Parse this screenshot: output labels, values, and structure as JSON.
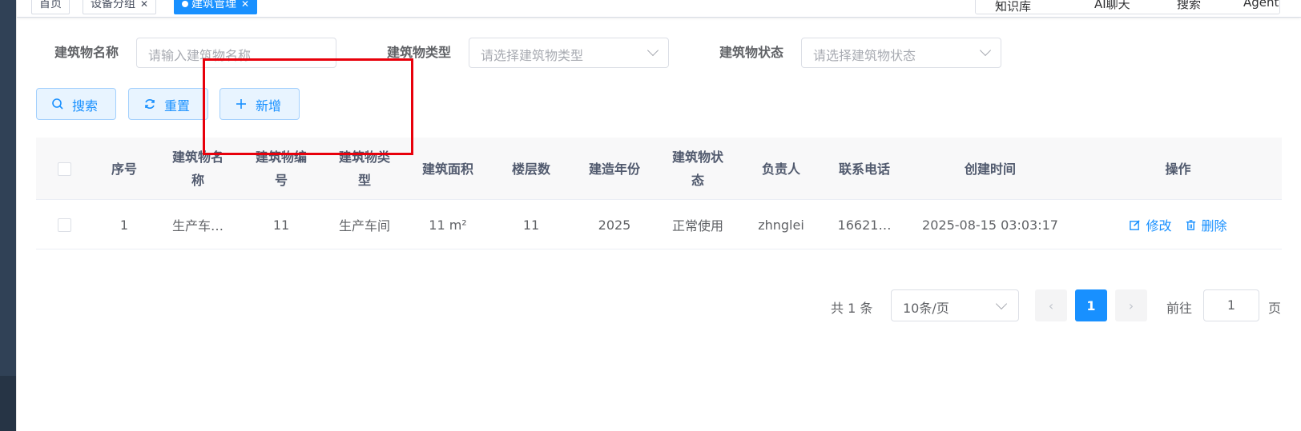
{
  "tags": [
    {
      "label": "首页"
    },
    {
      "label": "设备分组"
    },
    {
      "label": "建筑管理"
    }
  ],
  "topnav": {
    "knowledge": "知识库",
    "ai_chat": "AI聊天",
    "search": "搜索",
    "agent": "Agent"
  },
  "filters": {
    "name_label": "建筑物名称",
    "name_placeholder": "请输入建筑物名称",
    "type_label": "建筑物类型",
    "type_placeholder": "请选择建筑物类型",
    "status_label": "建筑物状态",
    "status_placeholder": "请选择建筑物状态"
  },
  "buttons": {
    "search": "搜索",
    "reset": "重置",
    "add": "新增"
  },
  "table": {
    "headers": {
      "index": "序号",
      "name": "建筑物名称",
      "code": "建筑物编号",
      "type": "建筑物类型",
      "area": "建筑面积",
      "floors": "楼层数",
      "year": "建造年份",
      "status": "建筑物状态",
      "owner": "负责人",
      "phone": "联系电话",
      "created": "创建时间",
      "actions": "操作"
    },
    "rows": [
      {
        "index": "1",
        "name": "生产车…",
        "code": "11",
        "type": "生产车间",
        "area": "11 m²",
        "floors": "11",
        "year": "2025",
        "status": "正常使用",
        "owner": "zhnglei",
        "phone": "16621…",
        "created": "2025-08-15 03:03:17",
        "edit": "修改",
        "delete": "删除"
      }
    ]
  },
  "pagination": {
    "total": "共 1 条",
    "page_size": "10条/页",
    "current": "1",
    "prev": "‹",
    "next": "›",
    "goto_label": "前往",
    "goto_value": "1",
    "page_unit": "页"
  },
  "colors": {
    "primary": "#1890ff",
    "highlight": "#e8000b",
    "sidebar": "#304156"
  }
}
